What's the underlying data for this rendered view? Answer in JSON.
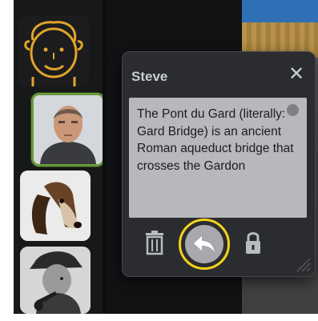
{
  "popup": {
    "title": "Steve",
    "close_glyph": "✕",
    "note_text": "The Pont du Gard (literally: Gard Bridge) is an ancient Roman aqueduct bridge that crosses the Gardon",
    "tools": [
      {
        "icon": "trash-icon"
      },
      {
        "icon": "reply-arrow-icon",
        "highlighted": true
      },
      {
        "icon": "lock-icon"
      }
    ]
  },
  "sidebar": {
    "avatars": [
      {
        "icon": "cartoon-face-avatar"
      },
      {
        "icon": "man-photo-avatar",
        "selected": true
      },
      {
        "icon": "basset-hound-avatar"
      },
      {
        "icon": "detective-pipe-avatar"
      }
    ]
  },
  "colors": {
    "highlight_ring": "#f2d21c",
    "selected_border": "#6a9a3d",
    "note_background": "#b7b8bd"
  }
}
